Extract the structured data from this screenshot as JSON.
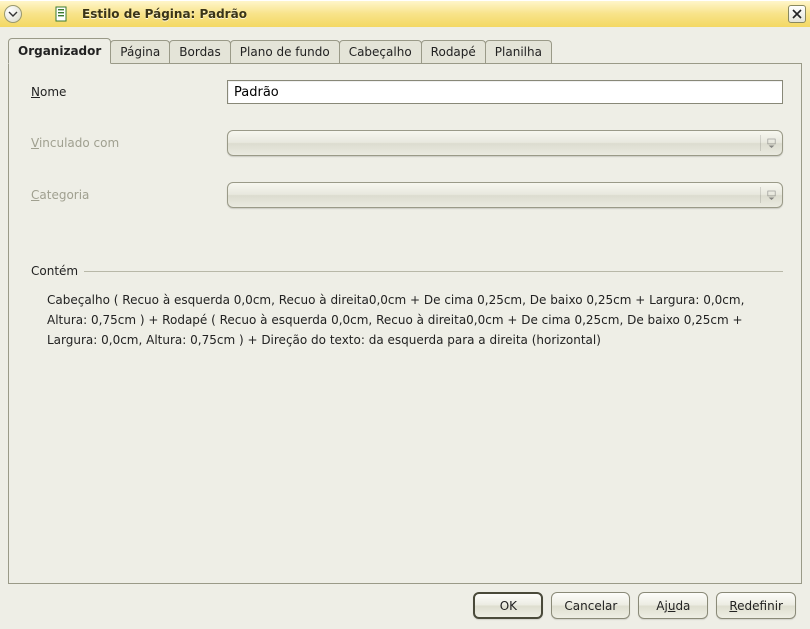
{
  "window": {
    "title": "Estilo de Página: Padrão"
  },
  "tabs": [
    {
      "label": "Organizador"
    },
    {
      "label": "Página"
    },
    {
      "label": "Bordas"
    },
    {
      "label": "Plano de fundo"
    },
    {
      "label": "Cabeçalho"
    },
    {
      "label": "Rodapé"
    },
    {
      "label": "Planilha"
    }
  ],
  "form": {
    "name_label_prefix": "N",
    "name_label_rest": "ome",
    "name_value": "Padrão",
    "linked_label_prefix": "V",
    "linked_label_rest": "inculado com",
    "linked_value": "",
    "category_label_prefix": "C",
    "category_label_rest": "ategoria",
    "category_value": ""
  },
  "contains": {
    "title": "Contém",
    "text": "Cabeçalho ( Recuo à esquerda 0,0cm, Recuo à direita0,0cm + De cima 0,25cm, De baixo 0,25cm + Largura: 0,0cm, Altura: 0,75cm )  + Rodapé ( Recuo à esquerda 0,0cm, Recuo à direita0,0cm + De cima 0,25cm, De baixo 0,25cm + Largura: 0,0cm, Altura: 0,75cm )  + Direção do texto: da esquerda para a direita (horizontal)"
  },
  "buttons": {
    "ok": "OK",
    "cancel": "Cancelar",
    "help_prefix": "Aj",
    "help_underline": "u",
    "help_rest": "da",
    "reset_prefix": "R",
    "reset_rest": "edefinir"
  }
}
